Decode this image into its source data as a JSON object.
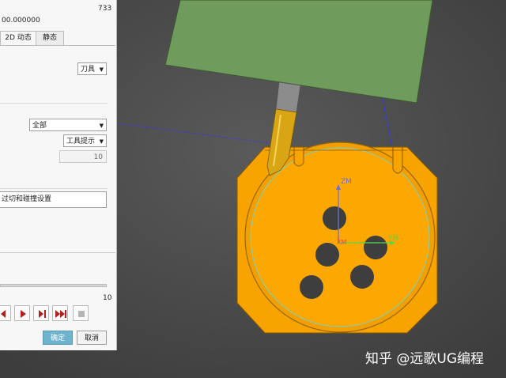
{
  "title_bar": {
    "right_number": "733"
  },
  "coordinate_readout": "00.000000",
  "tabs": [
    {
      "label": "2D 动态"
    },
    {
      "label": "静态"
    }
  ],
  "settings": {
    "tool_dropdown": "刀具",
    "all_dropdown": "全部",
    "tool_hint_dropdown": "工具提示",
    "number_field_value": "10",
    "collision_settings_button": "过切和碰撞设置"
  },
  "animation": {
    "speed_value": "10",
    "controls": [
      "step-back",
      "play-reverse",
      "play-forward",
      "step-forward",
      "fast-forward",
      "stop"
    ]
  },
  "footer": {
    "ok_label": "确定",
    "cancel_label": "取消"
  },
  "axis_labels": {
    "z": "ZM",
    "x": "XM",
    "y": "YM"
  },
  "watermark": "知乎 @远歌UG编程",
  "colors": {
    "part": "#f7a300",
    "tool_holder": "#6f9b5c",
    "tool_shank": "#d9a514",
    "background": "#4a4a4a",
    "ok_button": "#6fb3cf",
    "axis_z": "#6f6fd9",
    "axis_x": "#d9504d",
    "axis_y": "#4fd94f"
  }
}
